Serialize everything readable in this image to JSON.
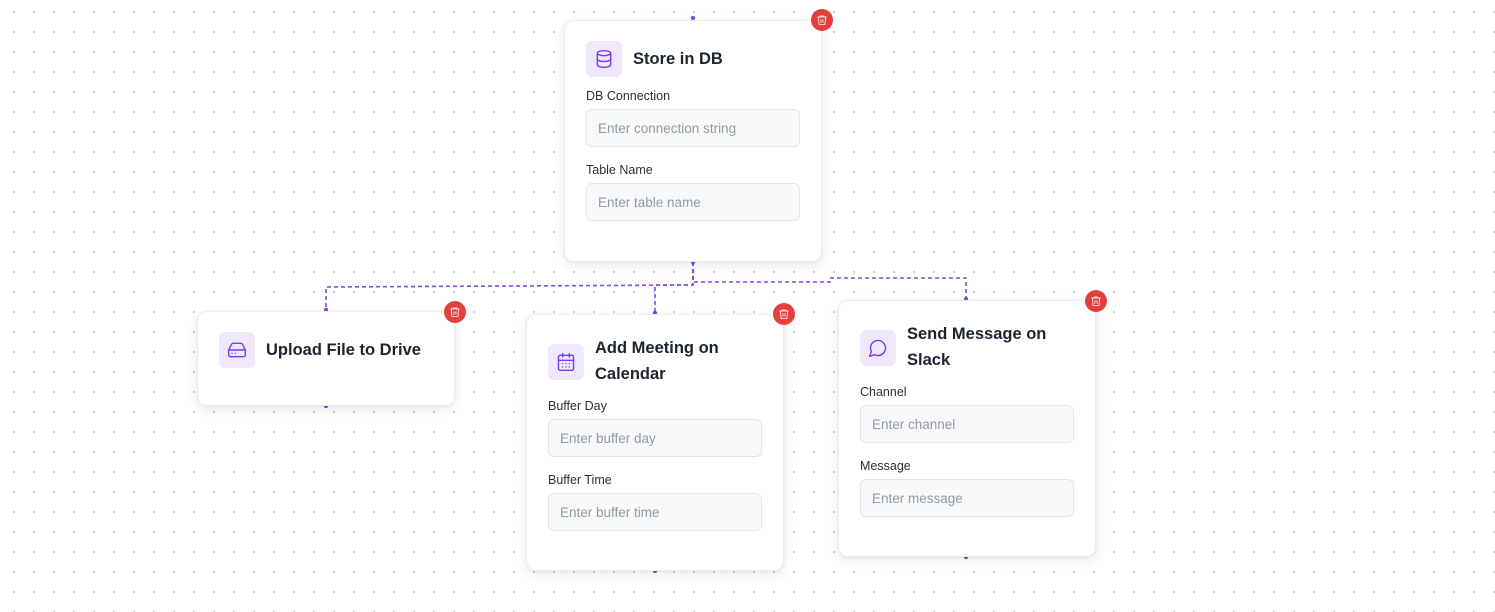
{
  "colors": {
    "accent": "#7c4ddb",
    "icon_bg": "#efe8fd",
    "delete": "#e53e3e",
    "canvas_dots": "#c9cbd1"
  },
  "nodes": {
    "store_db": {
      "title": "Store in DB",
      "icon": "database-icon",
      "fields": [
        {
          "label": "DB Connection",
          "placeholder": "Enter connection string",
          "value": ""
        },
        {
          "label": "Table Name",
          "placeholder": "Enter table name",
          "value": ""
        }
      ]
    },
    "upload_drive": {
      "title": "Upload File to Drive",
      "icon": "hard-drive-icon"
    },
    "add_meeting": {
      "title": "Add Meeting on Calendar",
      "icon": "calendar-icon",
      "fields": [
        {
          "label": "Buffer Day",
          "placeholder": "Enter buffer day",
          "value": ""
        },
        {
          "label": "Buffer Time",
          "placeholder": "Enter buffer time",
          "value": ""
        }
      ]
    },
    "send_slack": {
      "title": "Send Message on Slack",
      "icon": "message-circle-icon",
      "fields": [
        {
          "label": "Channel",
          "placeholder": "Enter channel",
          "value": ""
        },
        {
          "label": "Message",
          "placeholder": "Enter message",
          "value": ""
        }
      ]
    }
  }
}
